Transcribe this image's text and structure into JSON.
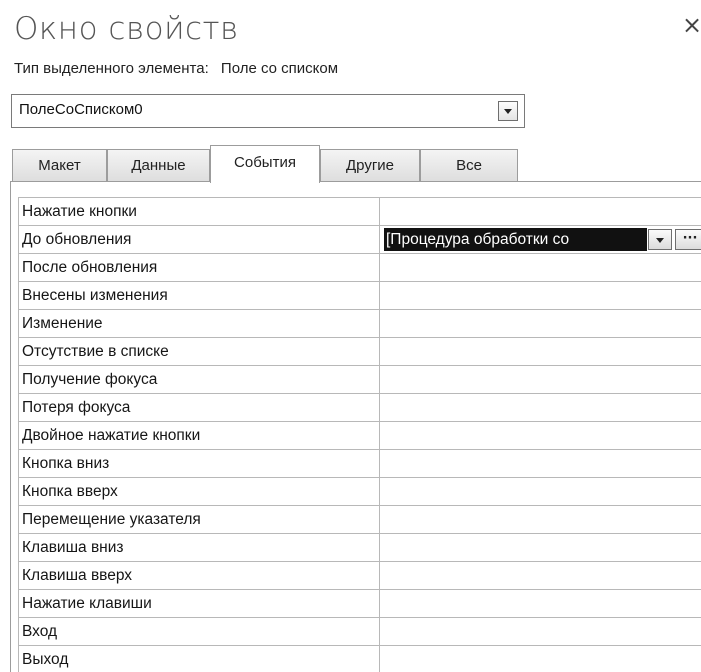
{
  "window": {
    "title": "Окно свойств",
    "close_glyph": "×"
  },
  "selection": {
    "type_label": "Тип выделенного элемента:",
    "type_value": "Поле со списком",
    "combo_value": "ПолеСоСписком0"
  },
  "tabs": [
    {
      "label": "Макет",
      "active": false
    },
    {
      "label": "Данные",
      "active": false
    },
    {
      "label": "События",
      "active": true
    },
    {
      "label": "Другие",
      "active": false
    },
    {
      "label": "Все",
      "active": false
    }
  ],
  "properties": [
    {
      "name": "Нажатие кнопки",
      "value": ""
    },
    {
      "name": "До обновления",
      "value": "[Процедура обработки со"
    },
    {
      "name": "После обновления",
      "value": ""
    },
    {
      "name": "Внесены изменения",
      "value": ""
    },
    {
      "name": "Изменение",
      "value": ""
    },
    {
      "name": "Отсутствие в списке",
      "value": ""
    },
    {
      "name": "Получение фокуса",
      "value": ""
    },
    {
      "name": "Потеря фокуса",
      "value": ""
    },
    {
      "name": "Двойное нажатие кнопки",
      "value": ""
    },
    {
      "name": "Кнопка вниз",
      "value": ""
    },
    {
      "name": "Кнопка вверх",
      "value": ""
    },
    {
      "name": "Перемещение указателя",
      "value": ""
    },
    {
      "name": "Клавиша вниз",
      "value": ""
    },
    {
      "name": "Клавиша вверх",
      "value": ""
    },
    {
      "name": "Нажатие клавиши",
      "value": ""
    },
    {
      "name": "Вход",
      "value": ""
    },
    {
      "name": "Выход",
      "value": ""
    }
  ],
  "builder_button_glyph": "···",
  "icons": {
    "close": "close-icon",
    "dropdown": "chevron-down-icon",
    "builder": "ellipsis-icon"
  },
  "colors": {
    "selected_value_bg": "#111111",
    "selected_value_fg": "#ffffff",
    "grid_line": "#b8b8b8"
  }
}
